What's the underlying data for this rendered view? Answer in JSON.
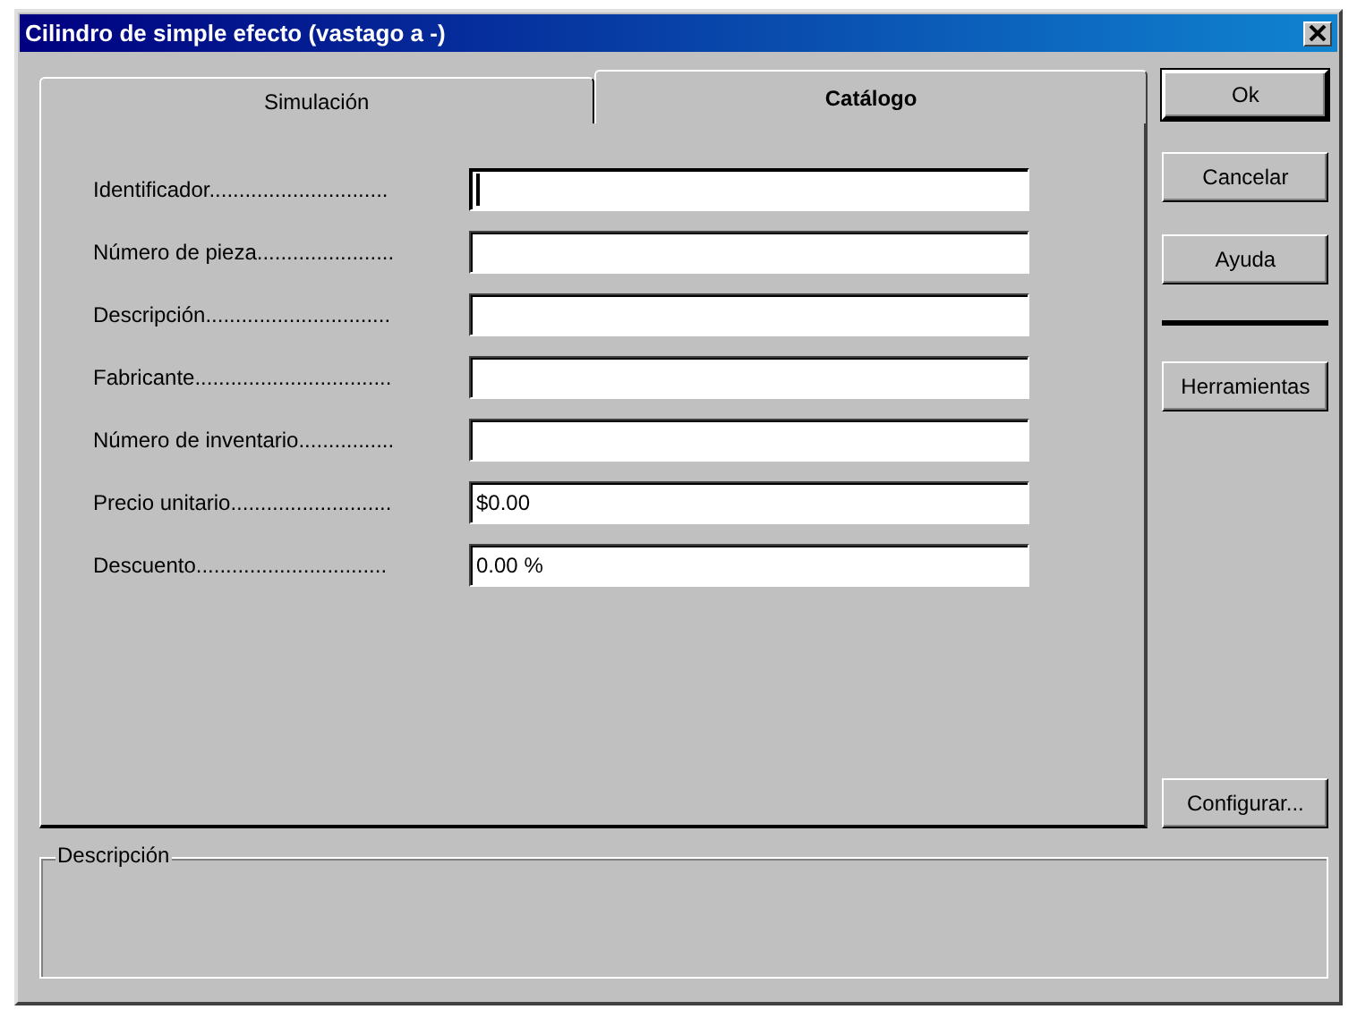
{
  "window": {
    "title": "Cilindro de simple efecto (vastago a -)"
  },
  "tabs": [
    {
      "label": "Simulación",
      "selected": false
    },
    {
      "label": "Catálogo",
      "selected": true
    }
  ],
  "fields": [
    {
      "label": "Identificador..............................",
      "focused": true
    },
    {
      "label": "Número de pieza.......................",
      "focused": false
    },
    {
      "label": "Descripción...............................",
      "focused": false
    },
    {
      "label": "Fabricante.................................",
      "focused": false
    },
    {
      "label": "Número de inventario................",
      "focused": false
    },
    {
      "label": "Precio unitario...........................",
      "value": "$0.00",
      "focused": false
    },
    {
      "label": "Descuento................................",
      "value": "0.00 %",
      "focused": false
    }
  ],
  "buttons": [
    {
      "label": "Ok",
      "default": true,
      "kind": "button"
    },
    {
      "label": "Cancelar",
      "default": false,
      "kind": "button"
    },
    {
      "label": "Ayuda",
      "default": false,
      "kind": "button"
    },
    {
      "kind": "separator"
    },
    {
      "label": "Herramientas",
      "default": false,
      "kind": "button"
    }
  ],
  "configure_button": {
    "label": "Configurar..."
  },
  "description_group": {
    "title": "Descripción"
  }
}
